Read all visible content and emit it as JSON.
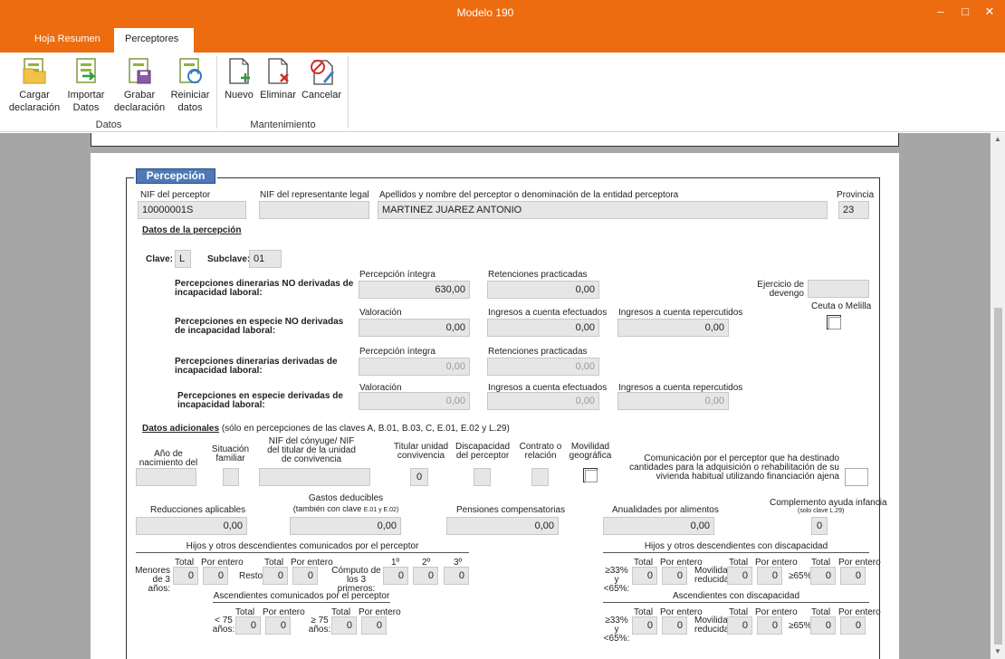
{
  "window": {
    "title": "Modelo 190",
    "min": "–",
    "max": "□",
    "close": "✕"
  },
  "tabs": [
    {
      "label": "Hoja Resumen"
    },
    {
      "label": "Perceptores"
    }
  ],
  "ribbon": {
    "buttons": [
      {
        "label1": "Cargar",
        "label2": "declaración",
        "icon": "load-declaration-icon"
      },
      {
        "label1": "Importar",
        "label2": "Datos",
        "icon": "import-data-icon"
      },
      {
        "label1": "Grabar",
        "label2": "declaración",
        "icon": "save-declaration-icon"
      },
      {
        "label1": "Reiniciar",
        "label2": "datos",
        "icon": "reset-data-icon"
      },
      {
        "label1": "Nuevo",
        "label2": "",
        "icon": "new-document-icon"
      },
      {
        "label1": "Eliminar",
        "label2": "",
        "icon": "delete-document-icon"
      },
      {
        "label1": "Cancelar",
        "label2": "",
        "icon": "cancel-icon"
      }
    ],
    "groups": {
      "datos": "Datos",
      "mantenimiento": "Mantenimiento"
    }
  },
  "form": {
    "section_title": "Percepción",
    "nif_perceptor_label": "NIF del perceptor",
    "nif_perceptor_value": "10000001S",
    "nif_representante_label": "NIF del representante legal",
    "nif_representante_value": "",
    "nombre_label": "Apellidos y nombre del perceptor o denominación de la entidad perceptora",
    "nombre_value": "MARTINEZ JUAREZ ANTONIO",
    "provincia_label": "Provincia",
    "provincia_value": "23",
    "datos_percepcion_title": "Datos de la percepción",
    "clave_label": "Clave:",
    "clave_value": "L",
    "subclave_label": "Subclave:",
    "subclave_value": "01",
    "row1_label": "Percepciones dinerarias NO derivadas de incapacidad laboral:",
    "row2_label": "Percepciones en especie NO derivadas de incapacidad laboral:",
    "row3_label": "Percepciones dinerarias derivadas de incapacidad laboral:",
    "row4_label": "Percepciones en especie derivadas de incapacidad laboral:",
    "percepcion_integra_label": "Percepción íntegra",
    "retenciones_label": "Retenciones practicadas",
    "valoracion_label": "Valoración",
    "ingresos_efectuados_label": "Ingresos a cuenta efectuados",
    "ingresos_repercutidos_label": "Ingresos a cuenta repercutidos",
    "row1_percepcion": "630,00",
    "row1_retenciones": "0,00",
    "row2_valoracion": "0,00",
    "row2_ingresos_efectuados": "0,00",
    "row2_ingresos_repercutidos": "0,00",
    "row3_percepcion": "0,00",
    "row3_retenciones": "0,00",
    "row4_valoracion": "0,00",
    "row4_ingresos_efectuados": "0,00",
    "row4_ingresos_repercutidos": "0,00",
    "ejercicio_label": "Ejercicio de devengo",
    "ejercicio_value": "",
    "ceuta_label": "Ceuta o Melilla",
    "datos_adicionales_title": "Datos adicionales",
    "datos_adicionales_note": "(sólo en percepciones de las claves A, B.01, B.03, C, E.01, E.02 y L.29)",
    "anio_nacimiento_label": "Año de nacimiento del perceptor",
    "situacion_familiar_label": "Situación familiar",
    "nif_conyuge_label": "NIF del cónyuge/ NIF del titular de la unidad de convivencia",
    "titular_unidad_label": "Titular unidad convivencia",
    "titular_unidad_value": "0",
    "discapacidad_label": "Discapacidad del perceptor",
    "contrato_label": "Contrato o relación",
    "movilidad_label": "Movilidad geográfica",
    "comunicacion_label": "Comunicación por el perceptor que ha destinado cantidades para la adquisición o rehabilitación de su vivienda habitual utilizando financiación ajena",
    "reducciones_label": "Reducciones aplicables",
    "reducciones_value": "0,00",
    "gastos_label": "Gastos deducibles",
    "gastos_sublabel_a": "(también con clave",
    "gastos_sublabel_b": "E.01 y E.02)",
    "gastos_value": "0,00",
    "pensiones_label": "Pensiones compensatorias",
    "pensiones_value": "0,00",
    "anualidades_label": "Anualidades por alimentos",
    "anualidades_value": "0,00",
    "complemento_label": "Complemento ayuda infancia",
    "complemento_sublabel": "(solo clave L.29)",
    "complemento_value": "0",
    "hijos_title": "Hijos y otros descendientes comunicados por el perceptor",
    "hijos_disc_title": "Hijos y otros descendientes con discapacidad",
    "asc_title": "Ascendientes comunicados por el perceptor",
    "asc_disc_title": "Ascendientes con discapacidad",
    "total_label": "Total",
    "por_entero_label": "Por entero",
    "menores_label": "Menores de 3 años:",
    "resto_label": "Resto:",
    "computo_label": "Cómputo de los 3 primeros:",
    "primero_label": "1º",
    "segundo_label": "2º",
    "tercero_label": "3º",
    "menor75_label": "< 75 años:",
    "mayor75_label": "≥ 75 años:",
    "ge33_label": "≥33% y <65%:",
    "movilidad_reducida_label": "Movilidad reducida:",
    "ge65_label": "≥65%:",
    "zero": "0"
  }
}
